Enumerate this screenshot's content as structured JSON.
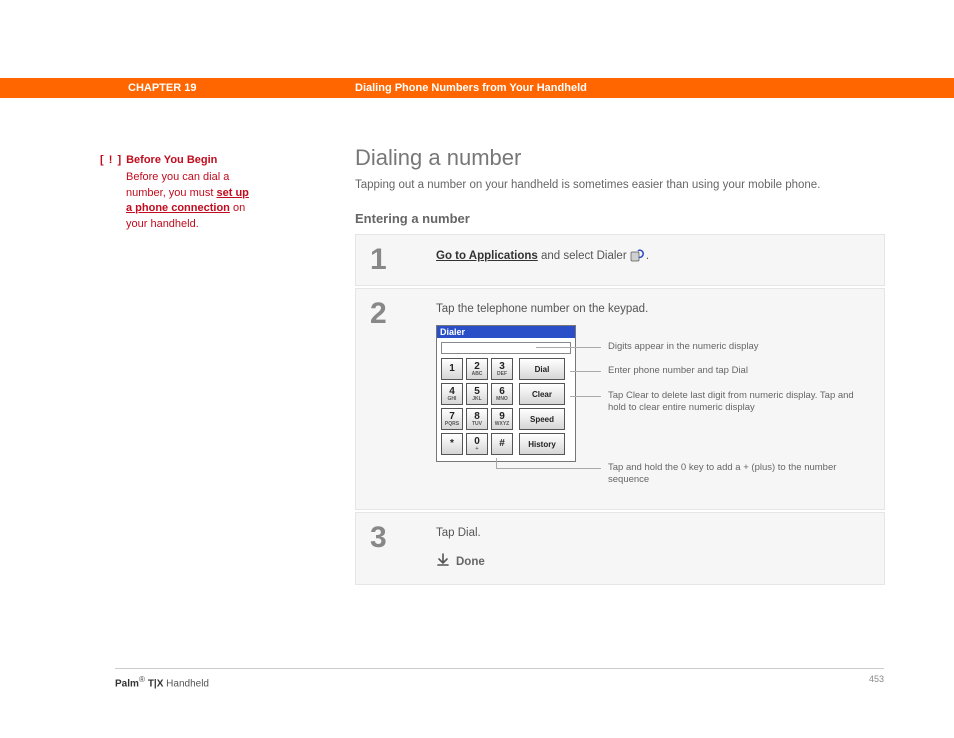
{
  "header": {
    "chapter": "CHAPTER 19",
    "title": "Dialing Phone Numbers from Your Handheld"
  },
  "sidebar": {
    "byb_label": "Before You Begin",
    "text1": "Before you can dial a number, you must ",
    "link": "set up a phone connection",
    "text2": " on your handheld."
  },
  "main": {
    "heading": "Dialing a number",
    "intro": "Tapping out a number on your handheld is sometimes easier than using your mobile phone.",
    "subheading": "Entering a number"
  },
  "steps": {
    "s1": {
      "num": "1",
      "link": "Go to Applications",
      "text": " and select Dialer "
    },
    "s2": {
      "num": "2",
      "text": "Tap the telephone number on the keypad."
    },
    "s3": {
      "num": "3",
      "text": "Tap Dial.",
      "done": "Done"
    }
  },
  "dialer": {
    "title": "Dialer",
    "keys": [
      {
        "big": "1",
        "sub": ""
      },
      {
        "big": "2",
        "sub": "ABC"
      },
      {
        "big": "3",
        "sub": "DEF"
      },
      {
        "big": "4",
        "sub": "GHI"
      },
      {
        "big": "5",
        "sub": "JKL"
      },
      {
        "big": "6",
        "sub": "MNO"
      },
      {
        "big": "7",
        "sub": "PQRS"
      },
      {
        "big": "8",
        "sub": "TUV"
      },
      {
        "big": "9",
        "sub": "WXYZ"
      },
      {
        "big": "*",
        "sub": ""
      },
      {
        "big": "0",
        "sub": "+"
      },
      {
        "big": "#",
        "sub": ""
      }
    ],
    "side": [
      "Dial",
      "Clear",
      "Speed",
      "History"
    ]
  },
  "callouts": {
    "c1": "Digits appear in the numeric display",
    "c2": "Enter phone number and tap Dial",
    "c3": "Tap Clear to delete last digit from numeric display. Tap and hold to clear entire numeric display",
    "c4": "Tap and hold the 0 key to add a + (plus) to the number sequence"
  },
  "footer": {
    "brand": "Palm",
    "model": " T|X",
    "suffix": " Handheld",
    "page": "453"
  }
}
